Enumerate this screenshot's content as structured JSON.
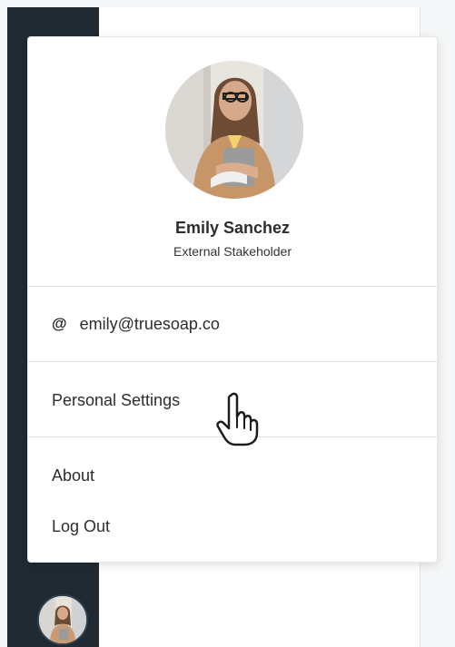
{
  "user": {
    "name": "Emily Sanchez",
    "role": "External Stakeholder",
    "email": "emily@truesoap.co"
  },
  "menu": {
    "email_icon": "@",
    "items": [
      {
        "label": "Personal Settings"
      },
      {
        "label": "About"
      },
      {
        "label": "Log Out"
      }
    ]
  },
  "icons": {
    "email": "at-icon",
    "cursor": "hand-pointer-icon"
  },
  "colors": {
    "rail": "#1f2a33",
    "text": "#2d2d2d",
    "divider": "#dde1e5"
  }
}
